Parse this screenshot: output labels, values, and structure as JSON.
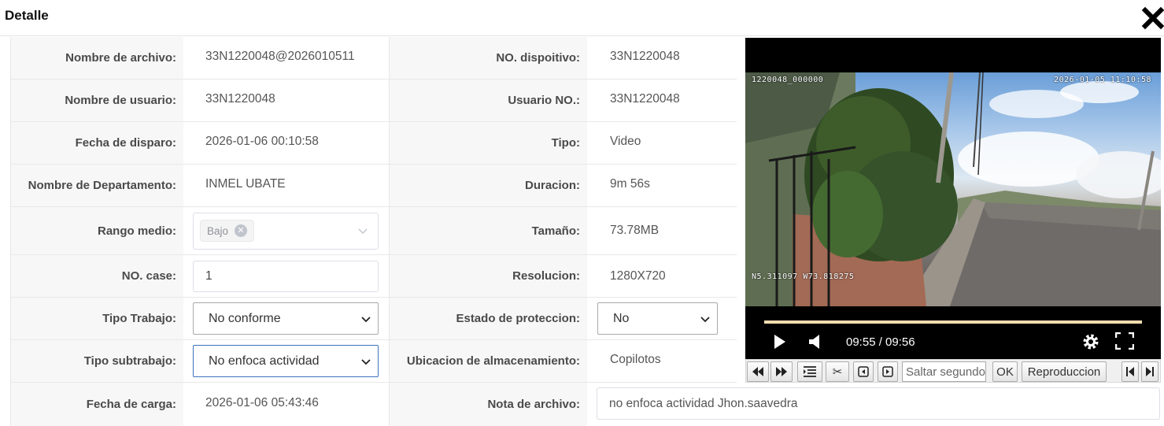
{
  "dialog": {
    "title": "Detalle"
  },
  "fields": {
    "nombre_archivo": {
      "label": "Nombre de archivo:",
      "value": "33N1220048@2026010511"
    },
    "no_dispositivo": {
      "label": "NO. dispoitivo:",
      "value": "33N1220048"
    },
    "nombre_usuario": {
      "label": "Nombre de usuario:",
      "value": "33N1220048"
    },
    "usuario_no": {
      "label": "Usuario NO.:",
      "value": "33N1220048"
    },
    "fecha_disparo": {
      "label": "Fecha de disparo:",
      "value": "2026-01-06 00:10:58"
    },
    "tipo": {
      "label": "Tipo:",
      "value": "Video"
    },
    "departamento": {
      "label": "Nombre de Departamento:",
      "value": "INMEL UBATE"
    },
    "duracion": {
      "label": "Duracion:",
      "value": "9m 56s"
    },
    "rango_medio": {
      "label": "Rango medio:",
      "tag": "Bajo"
    },
    "tamano": {
      "label": "Tamaño:",
      "value": "73.78MB"
    },
    "no_case": {
      "label": "NO. case:",
      "value": "1"
    },
    "resolucion": {
      "label": "Resolucion:",
      "value": "1280X720"
    },
    "tipo_trabajo": {
      "label": "Tipo Trabajo:",
      "selected": "No conforme"
    },
    "estado_proteccion": {
      "label": "Estado de proteccion:",
      "selected": "No"
    },
    "tipo_subtrabajo": {
      "label": "Tipo subtrabajo:",
      "selected": "No enfoca actividad"
    },
    "ubicacion": {
      "label": "Ubicacion de almacenamiento:",
      "value": "Copilotos"
    },
    "fecha_carga": {
      "label": "Fecha de carga:",
      "value": "2026-01-06 05:43:46"
    },
    "nota_archivo": {
      "label": "Nota de archivo:",
      "value": "no enfoca actividad Jhon.saavedra"
    }
  },
  "player": {
    "osd_top_left": "1220048_000000",
    "osd_top_right": "2026-01-05 11:10:58",
    "osd_bottom_left": "N5.311097 W73.818275",
    "time": "09:55 / 09:56",
    "progress_fraction": 0.998
  },
  "toolbar": {
    "seek_placeholder": "Saltar segundo",
    "ok_label": "OK",
    "playback_label": "Reproduccion"
  }
}
